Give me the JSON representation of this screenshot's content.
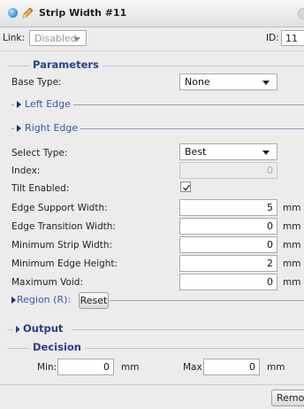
{
  "window": {
    "title": "Strip Width #11"
  },
  "toolbar": {
    "link_label": "Link:",
    "link_value": "Disabled",
    "id_label": "ID:",
    "id_value": "11"
  },
  "parameters": {
    "title": "Parameters",
    "base_type_label": "Base Type:",
    "base_type_value": "None",
    "left_edge_label": "Left Edge",
    "right_edge_label": "Right Edge",
    "select_type_label": "Select Type:",
    "select_type_value": "Best",
    "index_label": "Index:",
    "index_value": "0",
    "tilt_label": "Tilt Enabled:",
    "tilt_checked": true,
    "fields": [
      {
        "label": "Edge Support Width:",
        "value": "5",
        "unit": "mm"
      },
      {
        "label": "Edge Transition Width:",
        "value": "0",
        "unit": "mm"
      },
      {
        "label": "Minimum Strip Width:",
        "value": "0",
        "unit": "mm"
      },
      {
        "label": "Minimum Edge Height:",
        "value": "2",
        "unit": "mm"
      },
      {
        "label": "Maximum Void:",
        "value": "0",
        "unit": "mm"
      }
    ],
    "region_label": "Region (R):",
    "reset_label": "Reset"
  },
  "output": {
    "title": "Output"
  },
  "decision": {
    "title": "Decision",
    "min_label": "Min:",
    "min_value": "0",
    "min_unit": "mm",
    "max_label": "Max:",
    "max_value": "0",
    "max_unit": "mm"
  },
  "footer": {
    "remove_label": "Remove"
  },
  "colors": {
    "section_title": "#2b3d8f",
    "link_title": "#3a55b4",
    "background": "#ececec"
  }
}
